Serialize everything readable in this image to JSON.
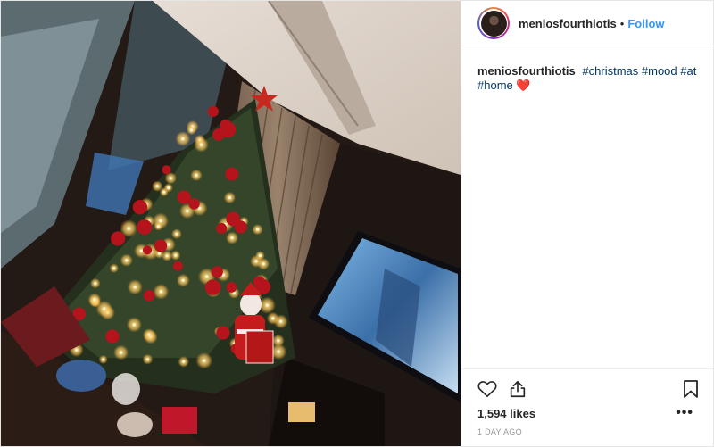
{
  "post": {
    "author": {
      "username": "meniosfourthiotis"
    },
    "header": {
      "separator": "•",
      "follow_label": "Follow"
    },
    "caption": {
      "username": "meniosfourthiotis",
      "hashtags": [
        "#christmas",
        "#mood",
        "#at",
        "#home"
      ],
      "emoji": "heart-emoji"
    },
    "likes_label": "1,594 likes",
    "timestamp": "1 DAY AGO",
    "more_label": "•••"
  },
  "icons": {
    "like": "heart-outline-icon",
    "share": "share-upload-icon",
    "save": "bookmark-icon",
    "more": "more-options-icon"
  },
  "colors": {
    "accent": "#3897f0",
    "hashtag": "#003569",
    "heart": "#d62828",
    "muted": "#999999"
  }
}
